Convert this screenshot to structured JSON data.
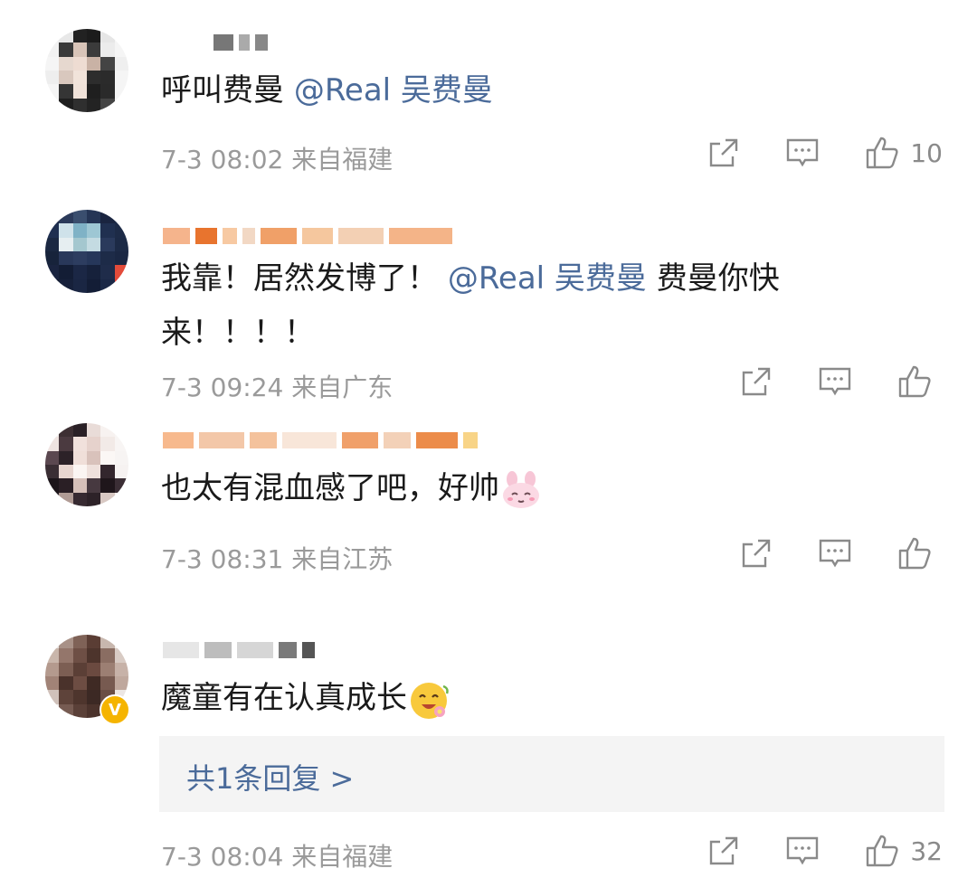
{
  "comments": [
    {
      "text_plain": "呼叫费曼 ",
      "mention": "@Real 吴费曼",
      "time": "7-3 08:02",
      "location": "来自福建",
      "likes": "10"
    },
    {
      "text_plain": "我靠！居然发博了！",
      "mention": "@Real 吴费曼",
      "text_after": " 费曼你快",
      "text_line2": "来！！！！",
      "time": "7-3 09:24",
      "location": "来自广东",
      "likes": ""
    },
    {
      "text_plain": "也太有混血感了吧，好帅",
      "time": "7-3 08:31",
      "location": "来自江苏",
      "likes": ""
    },
    {
      "text_plain": "魔童有在认真成长",
      "reply_label": "共1条回复 >",
      "verified_badge": "V",
      "time": "7-3 08:04",
      "location": "来自福建",
      "likes": "32"
    }
  ],
  "icons": {
    "share": "share-icon",
    "comment": "comment-icon",
    "like": "thumbs-up-icon"
  },
  "colors": {
    "mention": "#4b6b9a",
    "meta": "#9a9a9a",
    "reply_bg": "#f4f4f4"
  }
}
